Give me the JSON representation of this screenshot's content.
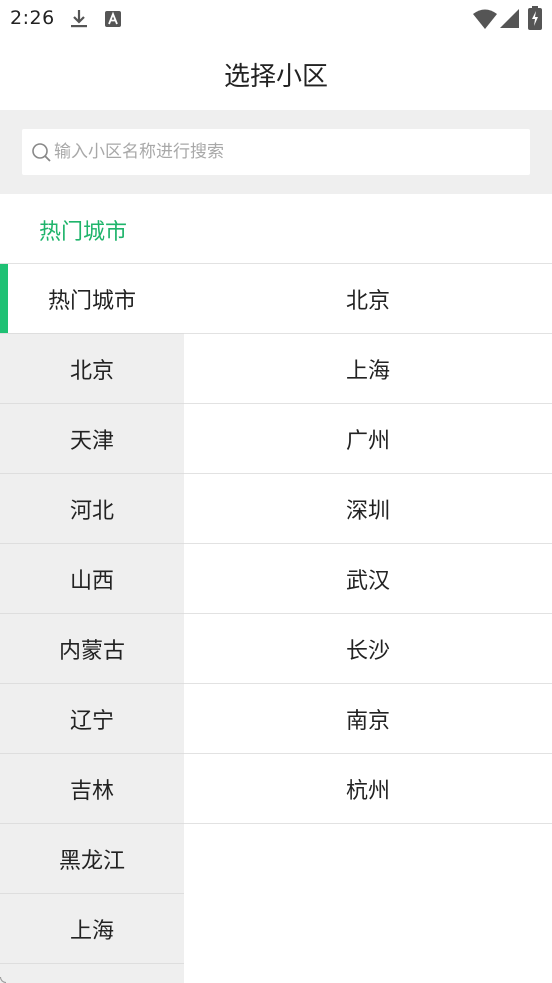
{
  "status_bar": {
    "time": "2:26",
    "icons": [
      "download-icon",
      "a-icon",
      "wifi-icon",
      "signal-icon",
      "battery-icon"
    ]
  },
  "title_bar": {
    "title": "选择小区"
  },
  "search": {
    "placeholder": "输入小区名称进行搜索",
    "value": ""
  },
  "section": {
    "title": "热门城市"
  },
  "left_list": {
    "items": [
      {
        "label": "热门城市",
        "selected": true
      },
      {
        "label": "北京"
      },
      {
        "label": "天津"
      },
      {
        "label": "河北"
      },
      {
        "label": "山西"
      },
      {
        "label": "内蒙古"
      },
      {
        "label": "辽宁"
      },
      {
        "label": "吉林"
      },
      {
        "label": "黑龙江"
      },
      {
        "label": "上海"
      }
    ]
  },
  "right_list": {
    "items": [
      {
        "label": "北京"
      },
      {
        "label": "上海"
      },
      {
        "label": "广州"
      },
      {
        "label": "深圳"
      },
      {
        "label": "武汉"
      },
      {
        "label": "长沙"
      },
      {
        "label": "南京"
      },
      {
        "label": "杭州"
      }
    ]
  },
  "colors": {
    "accent": "#1fb46b",
    "active_bar": "#1fc174",
    "panel_bg": "#efefef",
    "divider": "#e2e2e2"
  }
}
